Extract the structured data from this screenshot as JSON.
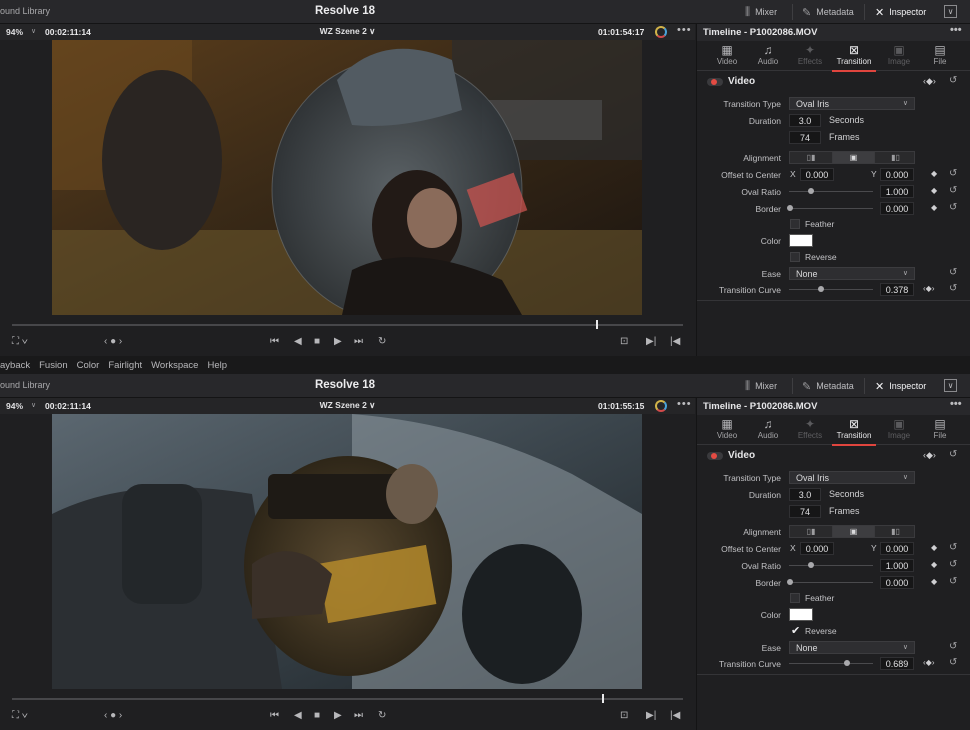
{
  "menubar": {
    "items": [
      "ayback",
      "Fusion",
      "Color",
      "Fairlight",
      "Workspace",
      "Help"
    ]
  },
  "panels": [
    {
      "titlebar": {
        "library_label": "ound Library",
        "app_title": "Resolve 18",
        "mixer_label": "Mixer",
        "metadata_label": "Metadata",
        "inspector_label": "Inspector"
      },
      "viewer": {
        "zoom": "94%",
        "duration_timecode": "00:02:11:14",
        "clip_name": "WZ Szene 2",
        "current_timecode": "01:01:54:17",
        "scrub_position": 0.87
      },
      "inspector": {
        "title": "Timeline - P1002086.MOV",
        "tabs": [
          "Video",
          "Audio",
          "Effects",
          "Transition",
          "Image",
          "File"
        ],
        "active_tab": "Transition",
        "section": "Video",
        "transition_type_label": "Transition Type",
        "transition_type": "Oval Iris",
        "duration_label": "Duration",
        "duration_seconds": "3.0",
        "seconds_unit": "Seconds",
        "duration_frames": "74",
        "frames_unit": "Frames",
        "alignment_label": "Alignment",
        "offset_label": "Offset to Center",
        "x_label": "X",
        "offset_x": "0.000",
        "y_label": "Y",
        "offset_y": "0.000",
        "oval_ratio_label": "Oval Ratio",
        "oval_ratio": "1.000",
        "border_label": "Border",
        "border": "0.000",
        "feather_label": "Feather",
        "feather_checked": false,
        "color_label": "Color",
        "color_value": "#ffffff",
        "reverse_label": "Reverse",
        "reverse_checked": false,
        "ease_label": "Ease",
        "ease": "None",
        "curve_label": "Transition Curve",
        "curve_value": "0.378"
      }
    },
    {
      "titlebar": {
        "library_label": "ound Library",
        "app_title": "Resolve 18",
        "mixer_label": "Mixer",
        "metadata_label": "Metadata",
        "inspector_label": "Inspector"
      },
      "viewer": {
        "zoom": "94%",
        "duration_timecode": "00:02:11:14",
        "clip_name": "WZ Szene 2",
        "current_timecode": "01:01:55:15",
        "scrub_position": 0.88
      },
      "inspector": {
        "title": "Timeline - P1002086.MOV",
        "tabs": [
          "Video",
          "Audio",
          "Effects",
          "Transition",
          "Image",
          "File"
        ],
        "active_tab": "Transition",
        "section": "Video",
        "transition_type_label": "Transition Type",
        "transition_type": "Oval Iris",
        "duration_label": "Duration",
        "duration_seconds": "3.0",
        "seconds_unit": "Seconds",
        "duration_frames": "74",
        "frames_unit": "Frames",
        "alignment_label": "Alignment",
        "offset_label": "Offset to Center",
        "x_label": "X",
        "offset_x": "0.000",
        "y_label": "Y",
        "offset_y": "0.000",
        "oval_ratio_label": "Oval Ratio",
        "oval_ratio": "1.000",
        "border_label": "Border",
        "border": "0.000",
        "feather_label": "Feather",
        "feather_checked": false,
        "color_label": "Color",
        "color_value": "#ffffff",
        "reverse_label": "Reverse",
        "reverse_checked": true,
        "ease_label": "Ease",
        "ease": "None",
        "curve_label": "Transition Curve",
        "curve_value": "0.689"
      }
    }
  ],
  "colors": {
    "accent_red": "#e0453e",
    "panel_bg": "#1f1f21"
  }
}
